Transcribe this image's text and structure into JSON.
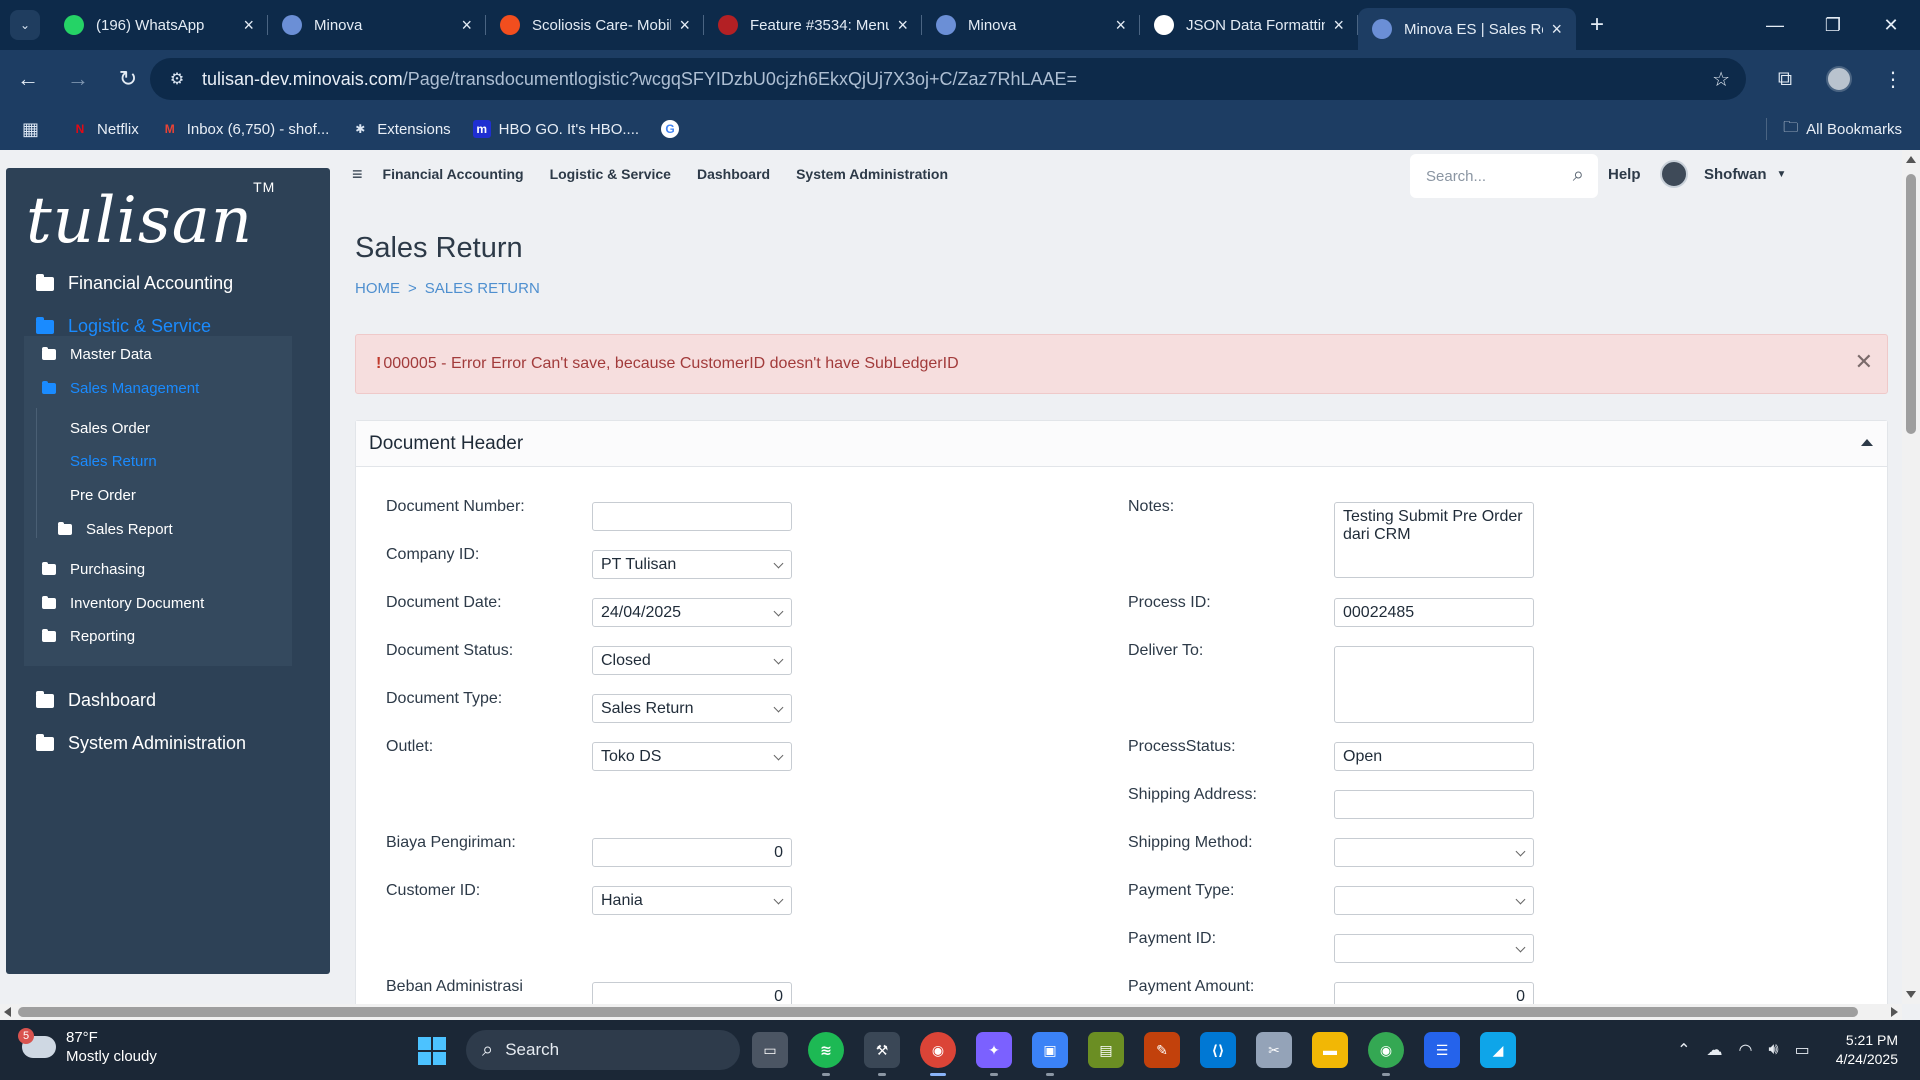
{
  "browser": {
    "tabs": [
      {
        "title": "(196) WhatsApp",
        "icon": "whatsapp-icon",
        "color": "#25d366"
      },
      {
        "title": "Minova",
        "icon": "hexagon-icon",
        "color": "#6b8fd6"
      },
      {
        "title": "Scoliosis Care- Mobil",
        "icon": "figma-icon",
        "color": "#f24e1e"
      },
      {
        "title": "Feature #3534: Menu",
        "icon": "redmine-icon",
        "color": "#b32024"
      },
      {
        "title": "Minova",
        "icon": "hexagon-icon",
        "color": "#6b8fd6"
      },
      {
        "title": "JSON Data Formattin",
        "icon": "openai-icon",
        "color": "#ffffff"
      },
      {
        "title": "Minova ES | Sales Ret",
        "icon": "hexagon-icon",
        "color": "#6b8fd6",
        "active": true
      }
    ],
    "url_host": "tulisan-dev.minovais.com",
    "url_path": "/Page/transdocumentlogistic?wcgqSFYIDzbU0cjzh6EkxQjUj7X3oj+C/Zaz7RhLAAE=",
    "bookmarks": [
      {
        "label": "Netflix",
        "icon": "netflix-icon"
      },
      {
        "label": "Inbox (6,750) - shof...",
        "icon": "gmail-icon"
      },
      {
        "label": "Extensions",
        "icon": "puzzle-icon"
      },
      {
        "label": "HBO GO. It's HBO....",
        "icon": "hbo-icon"
      }
    ],
    "all_bookmarks": "All Bookmarks"
  },
  "app": {
    "logo": "tulisan",
    "logo_tm": "TM",
    "sidebar": {
      "financial": "Financial Accounting",
      "logistic": "Logistic & Service",
      "master_data": "Master Data",
      "sales_management": "Sales Management",
      "sales_order": "Sales Order",
      "sales_return": "Sales Return",
      "pre_order": "Pre Order",
      "sales_report": "Sales Report",
      "purchasing": "Purchasing",
      "inventory": "Inventory Document",
      "reporting": "Reporting",
      "dashboard": "Dashboard",
      "sysadmin": "System Administration"
    },
    "topnav": {
      "items": [
        "Financial Accounting",
        "Logistic & Service",
        "Dashboard",
        "System Administration"
      ],
      "search_placeholder": "Search...",
      "help": "Help",
      "user": "Shofwan"
    },
    "page_title": "Sales Return",
    "breadcrumb": {
      "home": "HOME",
      "current": "SALES RETURN"
    },
    "alert": {
      "bang": "!",
      "message": "000005 - Error Error Can't save, because CustomerID doesn't have SubLedgerID"
    },
    "panel_title": "Document Header",
    "form_left": {
      "doc_number": {
        "label": "Document Number:",
        "value": ""
      },
      "company_id": {
        "label": "Company ID:",
        "value": "PT Tulisan"
      },
      "doc_date": {
        "label": "Document Date:",
        "value": "24/04/2025"
      },
      "doc_status": {
        "label": "Document Status:",
        "value": "Closed"
      },
      "doc_type": {
        "label": "Document Type:",
        "value": "Sales Return"
      },
      "outlet": {
        "label": "Outlet:",
        "value": "Toko DS"
      },
      "biaya": {
        "label": "Biaya Pengiriman:",
        "value": "0"
      },
      "customer_id": {
        "label": "Customer ID:",
        "value": "Hania"
      },
      "beban": {
        "label": "Beban Administrasi",
        "value": "0"
      }
    },
    "form_right": {
      "notes": {
        "label": "Notes:",
        "value": "Testing Submit Pre Order dari CRM"
      },
      "process_id": {
        "label": "Process ID:",
        "value": "00022485"
      },
      "deliver_to": {
        "label": "Deliver To:",
        "value": ""
      },
      "process_status": {
        "label": "ProcessStatus:",
        "value": "Open"
      },
      "shipping_address": {
        "label": "Shipping Address:",
        "value": ""
      },
      "shipping_method": {
        "label": "Shipping Method:",
        "value": ""
      },
      "payment_type": {
        "label": "Payment Type:",
        "value": ""
      },
      "payment_id": {
        "label": "Payment ID:",
        "value": ""
      },
      "payment_amount": {
        "label": "Payment Amount:",
        "value": "0"
      }
    }
  },
  "taskbar": {
    "weather_badge": "5",
    "temperature": "87°F",
    "condition": "Mostly cloudy",
    "search": "Search",
    "time": "5:21 PM",
    "date": "4/24/2025"
  }
}
